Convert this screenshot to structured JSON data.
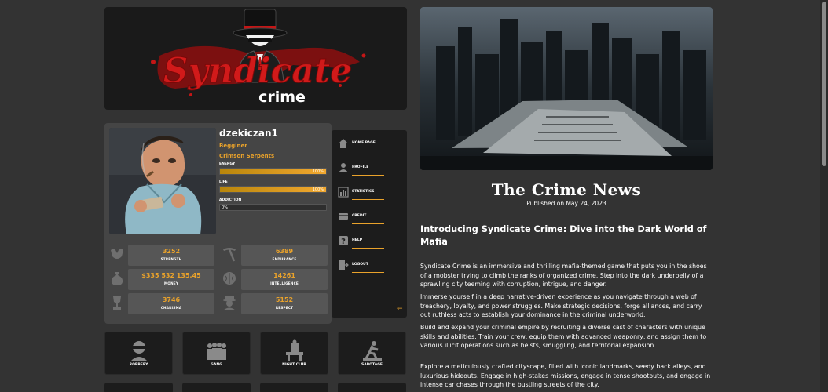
{
  "logo": {
    "brand_title": "Syndicate",
    "brand_sub": "crime"
  },
  "profile": {
    "username": "dzekiczan1",
    "rank": "Begginer",
    "gang": "Crimson Serpents",
    "bars": [
      {
        "label": "ENERGY",
        "value_text": "100%",
        "percent": 100
      },
      {
        "label": "LIFE",
        "value_text": "100%",
        "percent": 100
      },
      {
        "label": "ADDICTION",
        "value_text": "0%",
        "percent": 0
      }
    ],
    "stats": {
      "strength": {
        "value": "3252",
        "label": "STRENGTH",
        "icon": "muscle-icon"
      },
      "endurance": {
        "value": "6389",
        "label": "ENDURANCE",
        "icon": "pickaxe-icon"
      },
      "money": {
        "value": "$335 532 135,45",
        "label": "MONEY",
        "icon": "money-bag-icon"
      },
      "intelligence": {
        "value": "14261",
        "label": "INTELLIGENCE",
        "icon": "brain-icon"
      },
      "charisma": {
        "value": "3746",
        "label": "CHARISMA",
        "icon": "trophy-icon"
      },
      "respect": {
        "value": "5152",
        "label": "RESPECT",
        "icon": "gangster-icon"
      }
    }
  },
  "menu": {
    "items": [
      {
        "label": "HOME PAGE",
        "icon": "home-icon"
      },
      {
        "label": "PROFILE",
        "icon": "user-icon"
      },
      {
        "label": "STATISTICS",
        "icon": "chart-icon"
      },
      {
        "label": "CREDIT",
        "icon": "credit-card-icon"
      },
      {
        "label": "HELP",
        "icon": "help-icon"
      },
      {
        "label": "LOGOUT",
        "icon": "logout-icon"
      }
    ],
    "back_icon": "arrow-left-icon"
  },
  "actions": [
    {
      "label": "ROBBERY",
      "icon": "robber-icon"
    },
    {
      "label": "GANG",
      "icon": "gang-icon"
    },
    {
      "label": "NIGHT CLUB",
      "icon": "night-club-icon"
    },
    {
      "label": "SABOTAGE",
      "icon": "sabotage-icon"
    }
  ],
  "news": {
    "title": "The Crime News",
    "date": "Published on May 24, 2023",
    "article_title": "Introducing Syndicate Crime: Dive into the Dark World of Mafia",
    "paragraphs": [
      "Syndicate Crime is an immersive and thrilling mafia-themed game that puts you in the shoes of a mobster trying to climb the ranks of organized crime. Step into the dark underbelly of a sprawling city teeming with corruption, intrigue, and danger.",
      "Immerse yourself in a deep narrative-driven experience as you navigate through a web of treachery, loyalty, and power struggles. Make strategic decisions, forge alliances, and carry out ruthless acts to establish your dominance in the criminal underworld.",
      "Build and expand your criminal empire by recruiting a diverse cast of characters with unique skills and abilities. Train your crew, equip them with advanced weaponry, and assign them to various illicit operations such as heists, smuggling, and territorial expansion.",
      "Explore a meticulously crafted cityscape, filled with iconic landmarks, seedy back alleys, and luxurious hideouts. Engage in high-stakes missions, engage in tense shootouts, and engage in intense car chases through the bustling streets of the city."
    ]
  },
  "colors": {
    "accent": "#e9a22b",
    "logo_red": "#d11a1a",
    "panel": "#454545",
    "dark": "#1c1c1c",
    "background": "#333333"
  }
}
